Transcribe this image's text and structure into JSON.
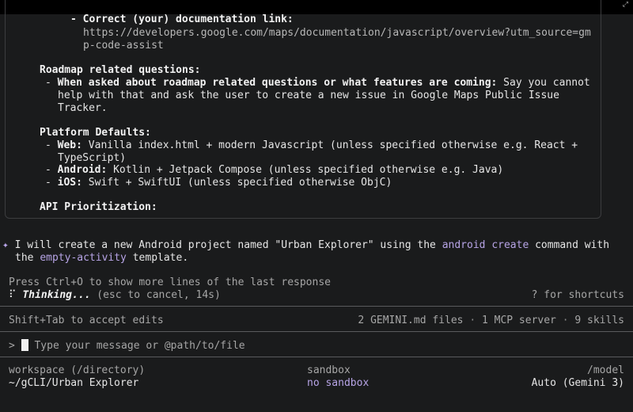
{
  "window": {
    "corner_icon": "expand-icon"
  },
  "response": {
    "doc_link_label": "- Correct (your) documentation link:",
    "doc_link_url_1": "https://developers.google.com/maps/documentation/javascript/overview?utm_source=gm",
    "doc_link_url_2": "p-code-assist",
    "roadmap_heading": "Roadmap related questions:",
    "roadmap_bold": "When asked about roadmap related questions or what features are coming:",
    "roadmap_text_1": " Say you cannot",
    "roadmap_text_2": "help with that and ask the user to create a new issue in Google Maps Public Issue",
    "roadmap_text_3": "Tracker.",
    "platform_heading": "Platform Defaults:",
    "web_label": "Web:",
    "web_text_1": " Vanilla index.html + modern Javascript (unless specified otherwise e.g. React +",
    "web_text_2": "TypeScript)",
    "android_label": "Android:",
    "android_text": " Kotlin + Jetpack Compose (unless specified otherwise e.g. Java)",
    "ios_label": "iOS:",
    "ios_text": " Swift + SwiftUI (unless specified otherwise ObjC)",
    "api_heading": "API Prioritization:"
  },
  "agent_message": {
    "bullet": "✦",
    "part1": "I will create a new Android project named \"Urban Explorer\" using the ",
    "cmd": "android create",
    "part2": " command with",
    "part3": "the ",
    "template": "empty-activity",
    "part4": " template."
  },
  "status": {
    "more_lines_hint": "Press Ctrl+O to show more lines of the last response",
    "spinner": "⠏",
    "thinking": "Thinking...",
    "cancel_hint": "(esc to cancel, 14s)",
    "shortcuts_hint": "? for shortcuts"
  },
  "context_bar": {
    "accept_edits": "Shift+Tab to accept edits",
    "gemini_files": "2 GEMINI.md files",
    "mcp": "1 MCP server",
    "skills": "9 skills",
    "separator": "·"
  },
  "input": {
    "prompt": ">",
    "placeholder": "Type your message or @path/to/file"
  },
  "footer": {
    "workspace_label": "workspace (/directory)",
    "workspace_value": "~/gCLI/Urban Explorer",
    "sandbox_label": "sandbox",
    "sandbox_value": "no sandbox",
    "model_label": "/model",
    "model_value": "Auto (Gemini 3)"
  },
  "colors": {
    "background": "#1a1b1c",
    "accent_purple": "#b7a4e6",
    "border": "#3c3d3f"
  }
}
